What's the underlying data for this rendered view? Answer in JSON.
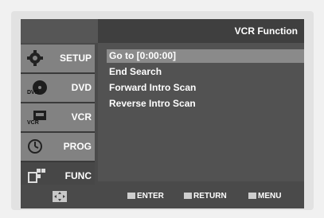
{
  "header": {
    "title": "VCR Function"
  },
  "sidebar": {
    "items": [
      {
        "label": "SETUP",
        "icon": "gear-icon"
      },
      {
        "label": "DVD",
        "icon": "dvd-icon"
      },
      {
        "label": "VCR",
        "icon": "vcr-icon"
      },
      {
        "label": "PROG",
        "icon": "timer-icon"
      },
      {
        "label": "FUNC",
        "icon": "func-icon"
      }
    ]
  },
  "menu": {
    "items": [
      {
        "label": "Go to [0:00:00]"
      },
      {
        "label": "End Search"
      },
      {
        "label": "Forward Intro Scan"
      },
      {
        "label": "Reverse Intro Scan"
      }
    ]
  },
  "footer": {
    "enter_label": "ENTER",
    "return_label": "RETURN",
    "menu_label": "MENU"
  }
}
